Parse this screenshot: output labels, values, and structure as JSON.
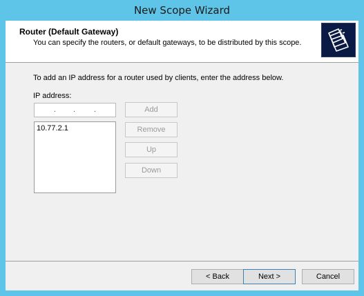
{
  "window": {
    "title": "New Scope Wizard"
  },
  "header": {
    "title": "Router (Default Gateway)",
    "description": "You can specify the routers, or default gateways, to be distributed by this scope."
  },
  "body": {
    "instruction": "To add an IP address for a router used by clients, enter the address below.",
    "ip_label": "IP address:",
    "ip_value": {
      "o1": "",
      "o2": "",
      "o3": "",
      "o4": ""
    },
    "ip_separator": ".",
    "routers": [
      "10.77.2.1"
    ]
  },
  "buttons": {
    "add": "Add",
    "remove": "Remove",
    "up": "Up",
    "down": "Down"
  },
  "footer": {
    "back": "< Back",
    "next": "Next >",
    "cancel": "Cancel"
  },
  "icons": {
    "header_icon": "folders-icon"
  },
  "colors": {
    "frame": "#5fc5e8",
    "icon_bg": "#0b1a45"
  }
}
